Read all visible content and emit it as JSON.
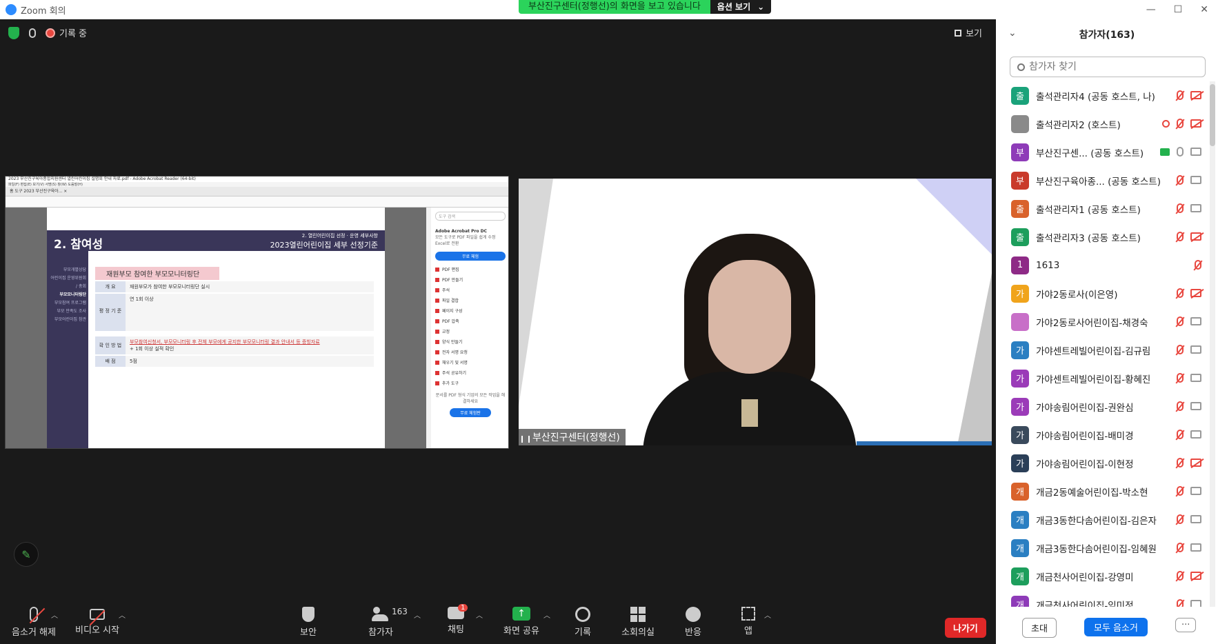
{
  "window": {
    "title": "Zoom 회의"
  },
  "share_banner": {
    "message": "부산진구센터(정행선)의 화면을 보고 있습니다",
    "options_label": "옵션 보기"
  },
  "status": {
    "recording_label": "기록 중",
    "view_label": "보기"
  },
  "shared_screen": {
    "window_title": "2023 부산진구육아종합지원센터 열린어린이집 설명회 안내 자료.pdf - Adobe Acrobat Reader (64-bit)",
    "menu": "파일(F)  편집(E)  보기(V)  서명(S)  창(W)  도움말(H)",
    "tabs": "홈   도구   2023 부산진구육아...  ×",
    "slide_title": "2. 참여성",
    "slide_sub1": "2. 열린어린이집 선정 · 운영 세부사항",
    "slide_sub2": "2023열린어린이집 세부 선정기준",
    "side_items": [
      "부모개별상담",
      "어린이집 운영위원회 / 총회",
      "부모모니터링단",
      "부모참여 프로그램",
      "부모 만족도 조사",
      "부모어린이집 참관"
    ],
    "side_active_index": 2,
    "pink_header": "재원부모 참여한 부모모니터링단",
    "rows": [
      {
        "k": "개  요",
        "v": "재원부모가 참여한 부모모니터링단 실시"
      },
      {
        "k": "평 정 기 준",
        "v": "연 1회 이상"
      },
      {
        "k": "확 인 방 법",
        "v": "부모참여신청서, 부모모니터링 후 전체 부모에게 공지한 부모모니터링 결과 안내서 등 증빙자료",
        "v2": "+ 1회 이상 실적 확인"
      },
      {
        "k": "배    점",
        "v": "5점"
      }
    ],
    "right_panel": {
      "search": "도구 검색",
      "promo_title": "Adobe Acrobat Pro DC",
      "promo_text": "모든 도구로 PDF 파일을 쉽게 수정 Excel로 전환",
      "promo_button": "무료 체험",
      "tools": [
        "PDF 편집",
        "PDF 만들기",
        "주석",
        "파일 결합",
        "페이지 구성",
        "PDF 압축",
        "교정",
        "양식 만들기",
        "전자 서명 요청",
        "채우기 및 서명",
        "주석 공유하기",
        "추가 도구"
      ],
      "footer_text": "문서를 PDF 형식 기업의 모든 작업을 해결하세요",
      "footer_button": "무료 체험판"
    }
  },
  "video": {
    "name_tag": "부산진구센터(정행선)"
  },
  "toolbar": {
    "mute": "음소거 해제",
    "video": "비디오 시작",
    "security": "보안",
    "participants": "참가자",
    "participants_count": "163",
    "chat": "채팅",
    "chat_badge": "1",
    "share": "화면 공유",
    "record": "기록",
    "breakout": "소회의실",
    "reactions": "반응",
    "apps": "앱",
    "leave": "나가기"
  },
  "panel": {
    "title": "참가자(163)",
    "search_placeholder": "참가자 찾기",
    "invite": "초대",
    "mute_all": "모두 음소거",
    "more": "···",
    "participants": [
      {
        "initial": "출",
        "color": "#1aa27a",
        "name": "출석관리자4 (공동 호스트, 나)",
        "mic": "off",
        "video": "off"
      },
      {
        "initial": "",
        "color": "#8a8a8a",
        "name": "출석관리자2 (호스트)",
        "mic": "off",
        "video": "off",
        "rec": true
      },
      {
        "initial": "부",
        "color": "#8e3bb8",
        "name": "부산진구센...    (공동 호스트)",
        "mic": "on",
        "video": "on",
        "share": true
      },
      {
        "initial": "부",
        "color": "#c93a2b",
        "name": "부산진구육아종...   (공동 호스트)",
        "mic": "off",
        "video": "on"
      },
      {
        "initial": "출",
        "color": "#d9622b",
        "name": "출석관리자1 (공동 호스트)",
        "mic": "off",
        "video": "on"
      },
      {
        "initial": "출",
        "color": "#1d9e5c",
        "name": "출석관리자3 (공동 호스트)",
        "mic": "off",
        "video": "off"
      },
      {
        "initial": "1",
        "color": "#8e2a86",
        "name": "1613",
        "mic": "off",
        "video": "none"
      },
      {
        "initial": "가",
        "color": "#f0a41c",
        "name": "가야2동로사(이은영)",
        "mic": "off",
        "video": "off"
      },
      {
        "initial": "",
        "color": "#c86fc8",
        "name": "가야2동로사어린이집-채경숙",
        "mic": "off",
        "video": "on"
      },
      {
        "initial": "가",
        "color": "#2b7fc2",
        "name": "가야센트레빌어린이집-김규림",
        "mic": "off",
        "video": "on"
      },
      {
        "initial": "가",
        "color": "#9b3bb8",
        "name": "가야센트레빌어린이집-황혜진",
        "mic": "off",
        "video": "on"
      },
      {
        "initial": "가",
        "color": "#9b3bb8",
        "name": "가야송림어린이집-권완심",
        "mic": "off",
        "video": "on"
      },
      {
        "initial": "가",
        "color": "#3a4a5c",
        "name": "가야송림어린이집-배미경",
        "mic": "off",
        "video": "on"
      },
      {
        "initial": "가",
        "color": "#2b3f58",
        "name": "가야송림어린이집-이현정",
        "mic": "off",
        "video": "off"
      },
      {
        "initial": "개",
        "color": "#d9622b",
        "name": "개금2동예술어린이집-박소현",
        "mic": "off",
        "video": "on"
      },
      {
        "initial": "개",
        "color": "#2b7fc2",
        "name": "개금3동한다솜어린이집-김은자",
        "mic": "off",
        "video": "on"
      },
      {
        "initial": "개",
        "color": "#2b7fc2",
        "name": "개금3동한다솜어린이집-임혜원",
        "mic": "off",
        "video": "on"
      },
      {
        "initial": "개",
        "color": "#1d9e5c",
        "name": "개금천사어린이집-강영미",
        "mic": "off",
        "video": "off"
      },
      {
        "initial": "개",
        "color": "#8e3bb8",
        "name": "개금천사어린이집-임미정",
        "mic": "off",
        "video": "on"
      }
    ]
  }
}
